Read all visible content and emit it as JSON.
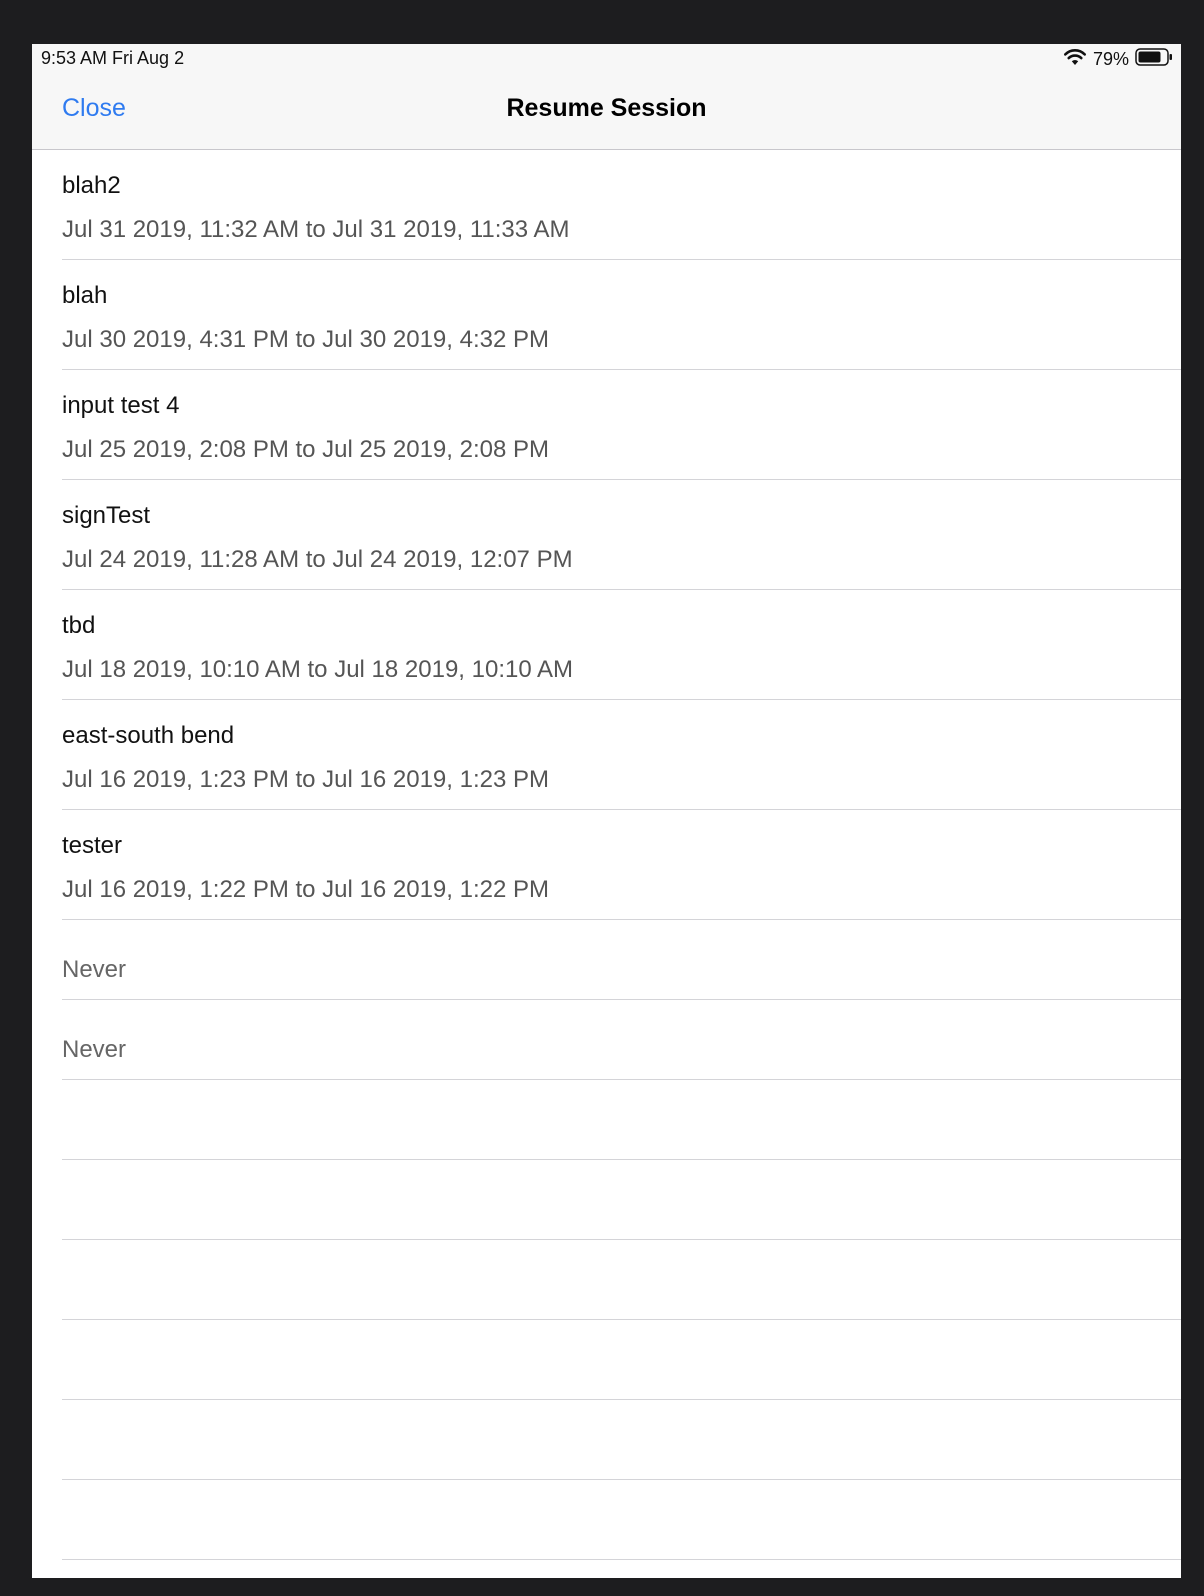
{
  "status_bar": {
    "time": "9:53 AM   Fri Aug 2",
    "battery_percent": "79%",
    "icons": [
      "wifi-icon",
      "battery-icon"
    ]
  },
  "nav": {
    "close_label": "Close",
    "title": "Resume Session",
    "accent_color": "#2f7bf0"
  },
  "sessions": [
    {
      "name": "blah2",
      "range": "Jul 31 2019, 11:32 AM to Jul 31 2019, 11:33 AM"
    },
    {
      "name": "blah",
      "range": "Jul 30 2019, 4:31 PM to Jul 30 2019, 4:32 PM"
    },
    {
      "name": "input test 4",
      "range": "Jul 25 2019, 2:08 PM to Jul 25 2019, 2:08 PM"
    },
    {
      "name": "signTest",
      "range": "Jul 24 2019, 11:28 AM to Jul 24 2019, 12:07 PM"
    },
    {
      "name": "tbd",
      "range": "Jul 18 2019, 10:10 AM to Jul 18 2019, 10:10 AM"
    },
    {
      "name": "east-south bend",
      "range": "Jul 16 2019, 1:23 PM to Jul 16 2019, 1:23 PM"
    },
    {
      "name": "tester",
      "range": "Jul 16 2019, 1:22 PM to Jul 16 2019, 1:22 PM"
    }
  ],
  "never_rows": [
    {
      "label": "Never"
    },
    {
      "label": "Never"
    }
  ]
}
